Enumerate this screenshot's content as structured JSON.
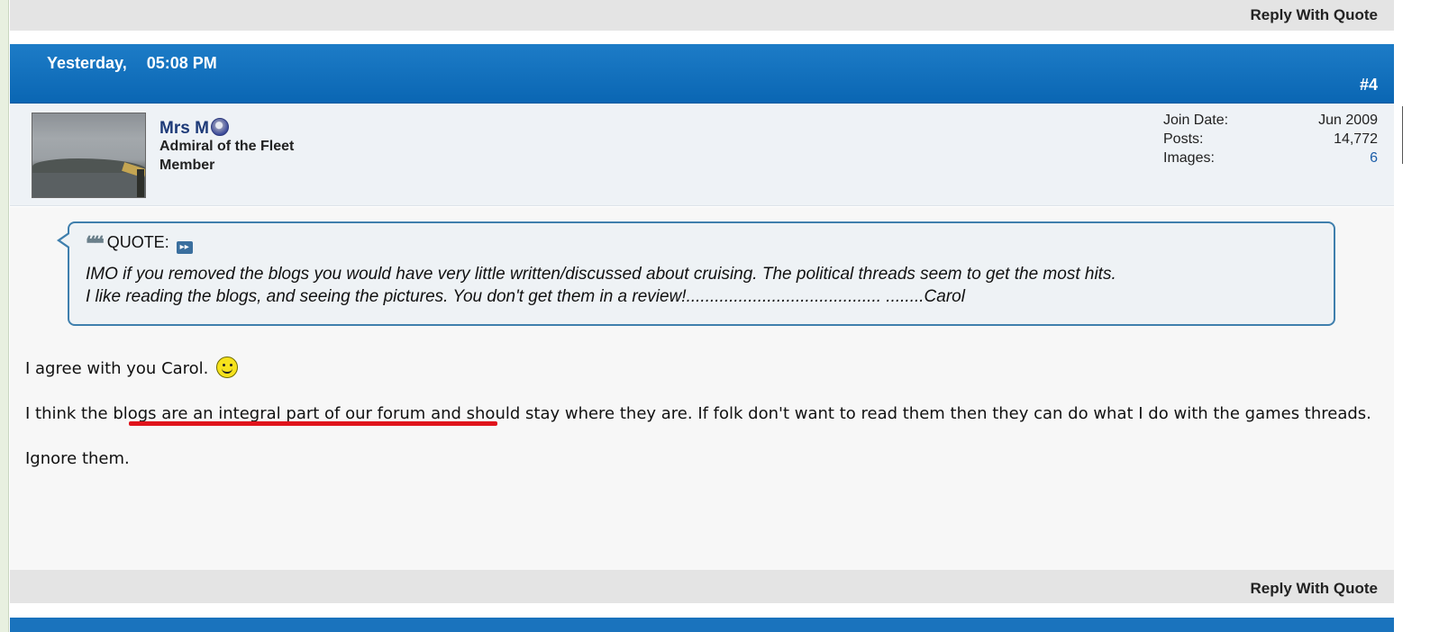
{
  "post": {
    "reply_with_quote_top": "Reply With Quote",
    "date": "Yesterday,",
    "time": "05:08 PM",
    "number": "#4",
    "reply_with_quote_bottom": "Reply With Quote"
  },
  "user": {
    "name": "Mrs M",
    "title": "Admiral of the Fleet",
    "rank": "Member",
    "status_icon": "offline-status-icon",
    "stats": [
      {
        "label": "Join Date:",
        "value": "Jun 2009"
      },
      {
        "label": "Posts:",
        "value": "14,772"
      },
      {
        "label": "Images:",
        "value": "6"
      }
    ]
  },
  "quote": {
    "label": "QUOTE:",
    "line1": "IMO if you removed the blogs you would have very little written/discussed about cruising. The political threads seem to get the most hits.",
    "line2": "I like reading the blogs, and seeing the pictures. You don't get them in a review!......................................... ........Carol"
  },
  "message": {
    "line1": "I agree with you Carol.",
    "line2_pre": "I think the ",
    "line2_highlight": "blogs are an integral part of our forum ",
    "line2_post": "and should stay where they are. If folk don't want to read them then they can do what I do with the games threads.",
    "line3": "Ignore them."
  },
  "colors": {
    "header_blue": "#0a66b3",
    "annotation_red": "#e0141c",
    "username_blue": "#1d3a78"
  }
}
